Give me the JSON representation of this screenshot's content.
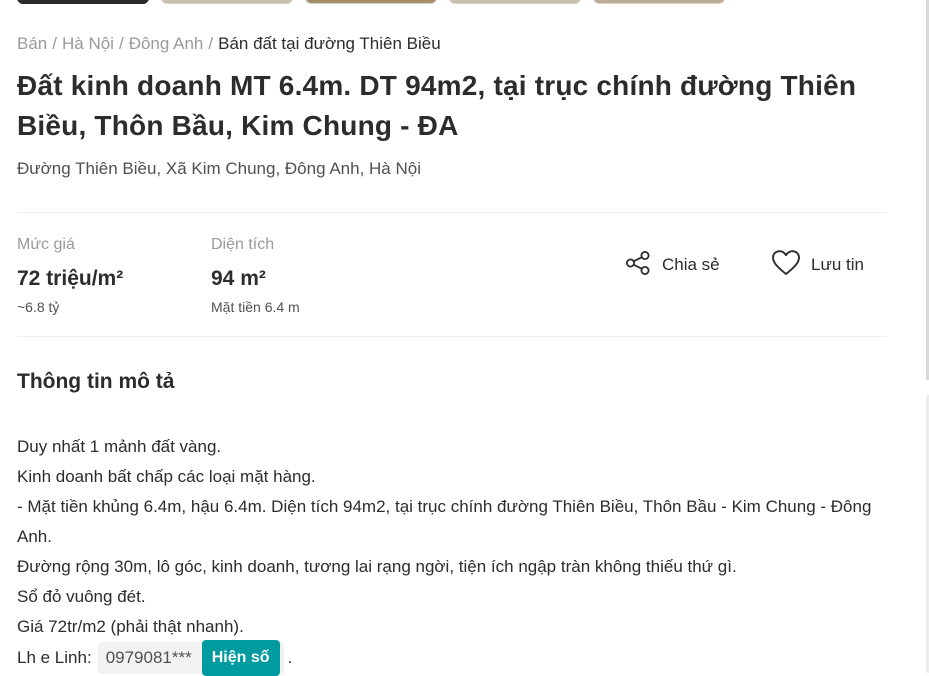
{
  "breadcrumb": {
    "items": [
      "Bán",
      "Hà Nội",
      "Đông Anh"
    ],
    "current": "Bán đất tại đường Thiên Biều",
    "separator": "/"
  },
  "listing": {
    "title": "Đất kinh doanh MT 6.4m. DT 94m2, tại trục chính đường Thiên Biều, Thôn Bầu, Kim Chung - ĐA",
    "address": "Đường Thiên Biều, Xã Kim Chung, Đông Anh, Hà Nội"
  },
  "stats": {
    "price": {
      "label": "Mức giá",
      "value": "72 triệu/m²",
      "sub": "~6.8 tỷ"
    },
    "area": {
      "label": "Diện tích",
      "value": "94 m²",
      "sub": "Mặt tiền 6.4 m"
    }
  },
  "actions": {
    "share_label": "Chia sẻ",
    "save_label": "Lưu tin",
    "share_icon": "share-icon",
    "save_icon": "heart-icon"
  },
  "description": {
    "heading": "Thông tin mô tả",
    "lines": [
      "Duy nhất 1 mảnh đất vàng.",
      "Kinh doanh bất chấp các loại mặt hàng.",
      "- Mặt tiền khủng 6.4m, hậu 6.4m. Diện tích 94m2, tại trục chính đường Thiên Biều, Thôn Bầu - Kim Chung - Đông Anh.",
      "Đường rộng 30m, lô góc, kinh doanh, tương lai rạng ngời, tiện ích ngập tràn không thiếu thứ gì.",
      "Sổ đỏ vuông đét.",
      "Giá 72tr/m2 (phải thật nhanh)."
    ],
    "contact_prefix": "Lh e Linh:",
    "phone_masked": "0979081***",
    "reveal_label": "Hiện số",
    "contact_suffix": "."
  },
  "colors": {
    "accent": "#009ba1",
    "text": "#2c2c2c",
    "muted": "#999999"
  }
}
